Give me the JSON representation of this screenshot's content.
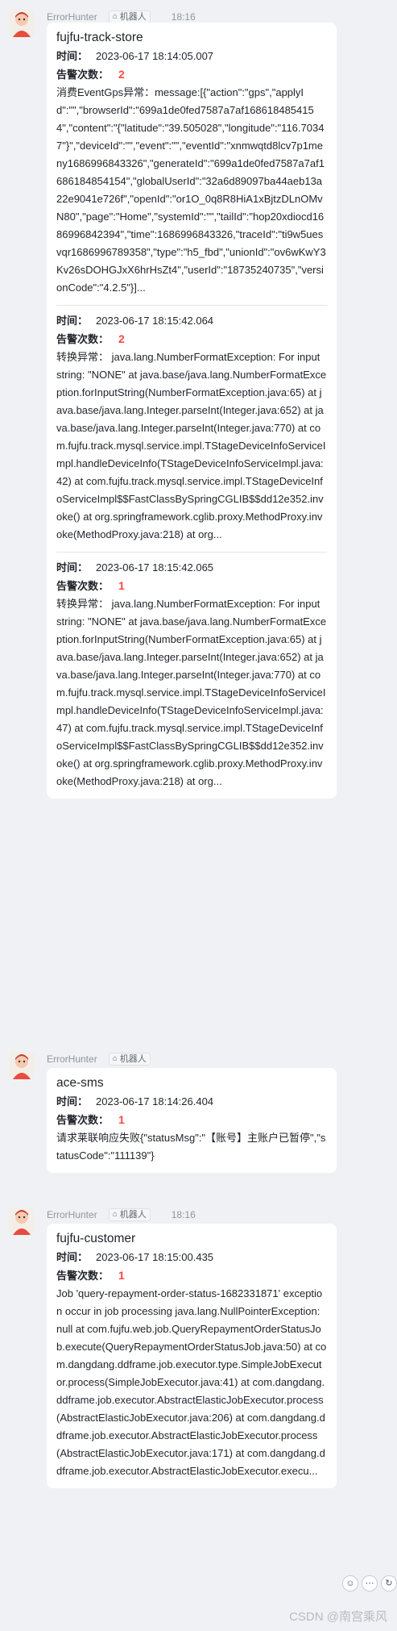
{
  "bot_tag_label": "机器人",
  "labels": {
    "time": "时间：",
    "count": "告警次数："
  },
  "messages": [
    {
      "sender": "ErrorHunter",
      "time": "18:16",
      "title": "fujfu-track-store",
      "alerts": [
        {
          "time": "2023-06-17 18:14:05.007",
          "count": "2",
          "text": "消费EventGps异常：message:[{\"action\":\"gps\",\"applyId\":\"\",\"browserId\":\"699a1de0fed7587a7af1686184854154\",\"content\":\"{\"latitude\":\"39.505028\",\"longitude\":\"116.70347\"}\",\"deviceId\":\"\",\"event\":\"\",\"eventId\":\"xnmwqtd8lcv7p1meny1686996843326\",\"generateId\":\"699a1de0fed7587a7af1686184854154\",\"globalUserId\":\"32a6d89097ba44aeb13a22e9041e726f\",\"openId\":\"or1O_0q8R8HiA1xBjtzDLnOMvN80\",\"page\":\"Home\",\"systemId\":\"\",\"tailId\":\"hop20xdiocd1686996842394\",\"time\":1686996843326,\"traceId\":\"ti9w5uesvqr1686996789358\",\"type\":\"h5_fbd\",\"unionId\":\"ov6wKwY3Kv26sDOHGJxX6hrHsZt4\",\"userId\":\"18735240735\",\"versionCode\":\"4.2.5\"}]..."
        },
        {
          "time": "2023-06-17 18:15:42.064",
          "count": "2",
          "text": "转换异常： java.lang.NumberFormatException: For input string: \"NONE\" at java.base/java.lang.NumberFormatException.forInputString(NumberFormatException.java:65) at java.base/java.lang.Integer.parseInt(Integer.java:652) at java.base/java.lang.Integer.parseInt(Integer.java:770) at com.fujfu.track.mysql.service.impl.TStageDeviceInfoServiceImpl.handleDeviceInfo(TStageDeviceInfoServiceImpl.java:42) at com.fujfu.track.mysql.service.impl.TStageDeviceInfoServiceImpl$$FastClassBySpringCGLIB$$dd12e352.invoke() at org.springframework.cglib.proxy.MethodProxy.invoke(MethodProxy.java:218) at org..."
        },
        {
          "time": "2023-06-17 18:15:42.065",
          "count": "1",
          "text": "转换异常： java.lang.NumberFormatException: For input string: \"NONE\" at java.base/java.lang.NumberFormatException.forInputString(NumberFormatException.java:65) at java.base/java.lang.Integer.parseInt(Integer.java:652) at java.base/java.lang.Integer.parseInt(Integer.java:770) at com.fujfu.track.mysql.service.impl.TStageDeviceInfoServiceImpl.handleDeviceInfo(TStageDeviceInfoServiceImpl.java:47) at com.fujfu.track.mysql.service.impl.TStageDeviceInfoServiceImpl$$FastClassBySpringCGLIB$$dd12e352.invoke() at org.springframework.cglib.proxy.MethodProxy.invoke(MethodProxy.java:218) at org..."
        }
      ]
    },
    {
      "sender": "ErrorHunter",
      "time": "",
      "title": "ace-sms",
      "alerts": [
        {
          "time": "2023-06-17 18:14:26.404",
          "count": "1",
          "text": "请求莱联响应失败{\"statusMsg\":\"【账号】主账户已暂停\",\"statusCode\":\"111139\"}"
        }
      ]
    },
    {
      "sender": "ErrorHunter",
      "time": "18:16",
      "title": "fujfu-customer",
      "alerts": [
        {
          "time": "2023-06-17 18:15:00.435",
          "count": "1",
          "text": "Job 'query-repayment-order-status-1682331871' exception occur in job processing java.lang.NullPointerException: null at com.fujfu.web.job.QueryRepaymentOrderStatusJob.execute(QueryRepaymentOrderStatusJob.java:50) at com.dangdang.ddframe.job.executor.type.SimpleJobExecutor.process(SimpleJobExecutor.java:41) at com.dangdang.ddframe.job.executor.AbstractElasticJobExecutor.process(AbstractElasticJobExecutor.java:206) at com.dangdang.ddframe.job.executor.AbstractElasticJobExecutor.process(AbstractElasticJobExecutor.java:171) at com.dangdang.ddframe.job.executor.AbstractElasticJobExecutor.execu..."
        }
      ]
    }
  ],
  "reactions": [
    "add-reaction-icon",
    "reply-icon",
    "more-icon"
  ],
  "watermark": "CSDN @南宫乘风"
}
